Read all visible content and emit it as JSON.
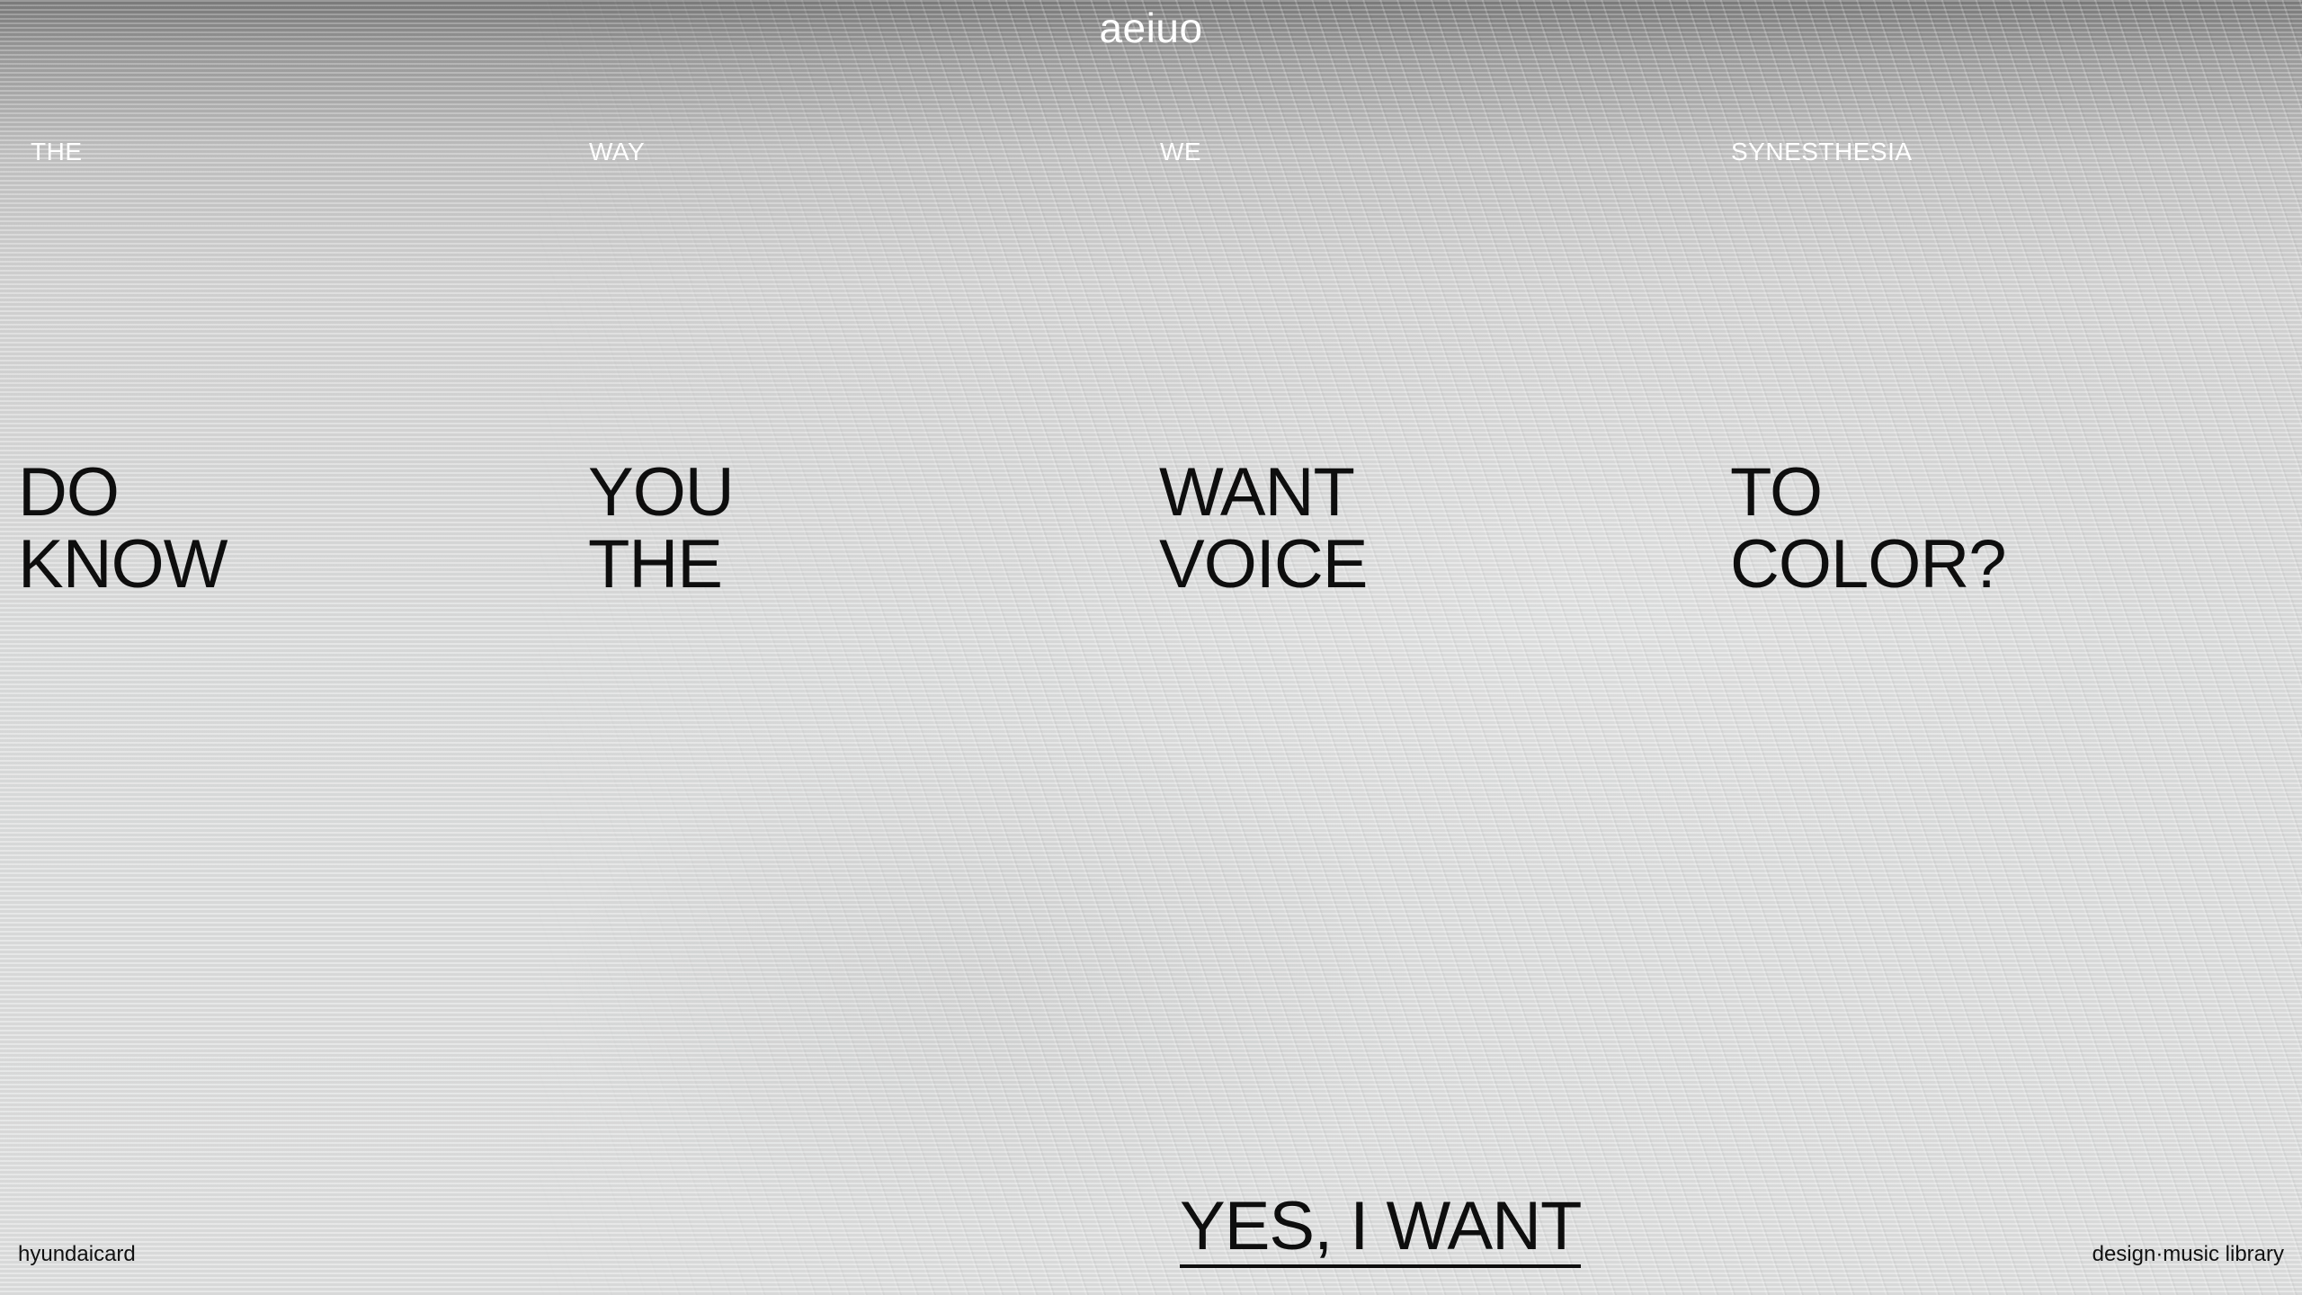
{
  "brand": {
    "title": "aeiuo"
  },
  "columns": [
    {
      "small": "THE",
      "big_line1": "DO",
      "big_line2": "KNOW"
    },
    {
      "small": "WAY",
      "big_line1": "YOU",
      "big_line2": "THE"
    },
    {
      "small": "WE",
      "big_line1": "WANT",
      "big_line2": "VOICE"
    },
    {
      "small": "SYNESTHESIA",
      "big_line1": "TO",
      "big_line2": "COLOR?"
    }
  ],
  "cta": {
    "label": "YES, I WANT"
  },
  "footer": {
    "left": "hyundaicard",
    "right": "design·music library"
  },
  "colors": {
    "text": "#0e0e0e",
    "light_text": "#ffffff",
    "background_top": "#7d7d7d",
    "background_bottom": "#e0e1e1"
  }
}
